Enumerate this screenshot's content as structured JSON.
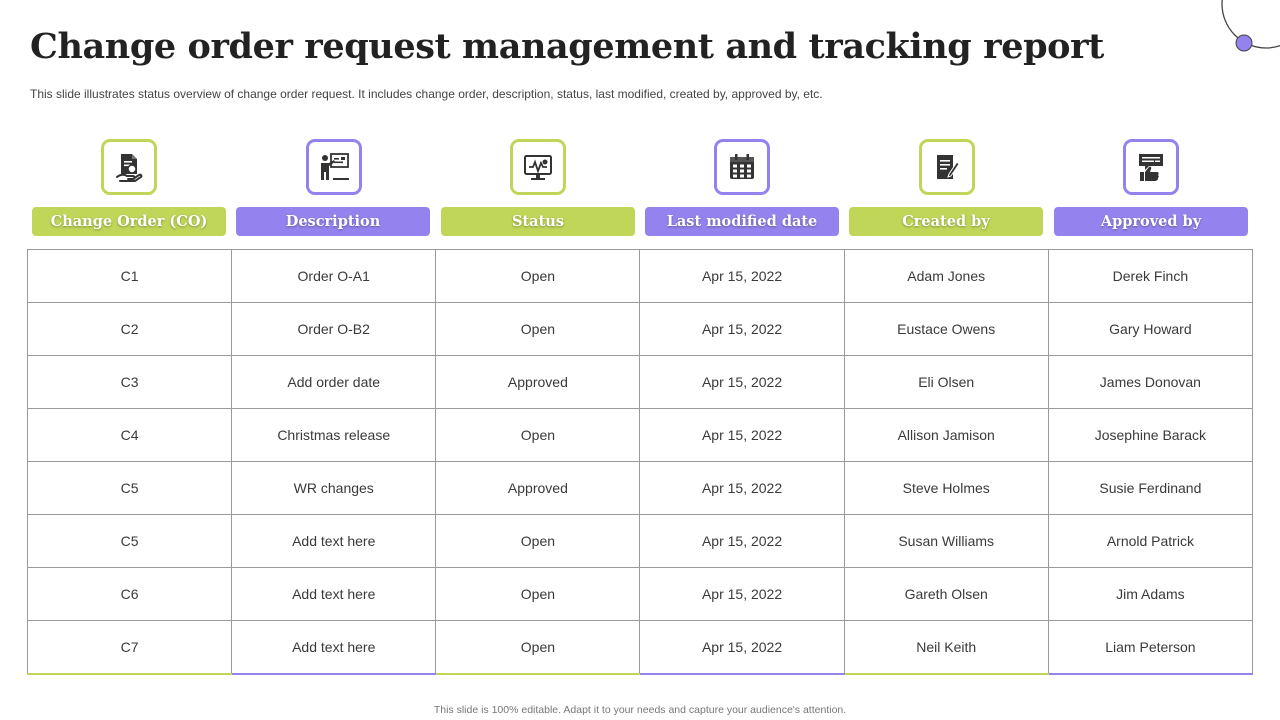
{
  "title": "Change order request management and tracking report",
  "subtitle": "This slide illustrates status overview of change order request. It includes change order, description, status, last modified, created by,  approved by,  etc.",
  "colors": {
    "green": "#bfd659",
    "purple": "#9483ee"
  },
  "columns": [
    {
      "label": "Change Order (CO)",
      "icon": "document-hand-icon"
    },
    {
      "label": "Description",
      "icon": "presenter-board-icon"
    },
    {
      "label": "Status",
      "icon": "monitor-chart-icon"
    },
    {
      "label": "Last modified date",
      "icon": "calendar-icon"
    },
    {
      "label": "Created by",
      "icon": "document-pen-icon"
    },
    {
      "label": "Approved by",
      "icon": "chat-thumbs-up-icon"
    }
  ],
  "rows": [
    [
      "C1",
      "Order  O-A1",
      "Open",
      "Apr 15, 2022",
      "Adam Jones",
      "Derek Finch"
    ],
    [
      "C2",
      "Order  O-B2",
      "Open",
      "Apr 15, 2022",
      "Eustace Owens",
      "Gary Howard"
    ],
    [
      "C3",
      "Add order date",
      "Approved",
      "Apr 15, 2022",
      "Eli Olsen",
      "James Donovan"
    ],
    [
      "C4",
      "Christmas release",
      "Open",
      "Apr 15, 2022",
      "Allison Jamison",
      "Josephine  Barack"
    ],
    [
      "C5",
      "WR changes",
      "Approved",
      "Apr 15, 2022",
      "Steve Holmes",
      "Susie Ferdinand"
    ],
    [
      "C5",
      "Add text here",
      "Open",
      "Apr 15, 2022",
      "Susan Williams",
      "Arnold Patrick"
    ],
    [
      "C6",
      "Add text here",
      "Open",
      "Apr 15, 2022",
      "Gareth Olsen",
      "Jim Adams"
    ],
    [
      "C7",
      "Add text here",
      "Open",
      "Apr 15, 2022",
      "Neil Keith",
      "Liam Peterson"
    ]
  ],
  "footer": "This slide is 100% editable.  Adapt it to your needs and capture your audience's attention."
}
